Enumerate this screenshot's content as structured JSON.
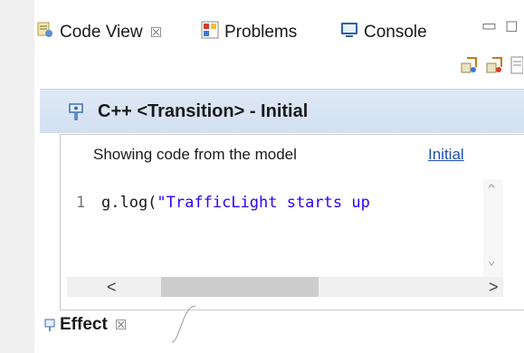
{
  "tabs": [
    {
      "label": "Code View",
      "icon": "code-view-icon",
      "active": true,
      "closable": true,
      "close_glyph": "☒"
    },
    {
      "label": "Problems",
      "icon": "problems-icon",
      "active": false
    },
    {
      "label": "Console",
      "icon": "console-icon",
      "active": false
    }
  ],
  "window_controls": {
    "minimize_glyph": "▭",
    "maximize_glyph": "◻"
  },
  "toolbar": {
    "icons": [
      "model-link-icon",
      "model-unlink-icon",
      "document-icon"
    ]
  },
  "header": {
    "icon": "transition-icon",
    "title": "C++ <Transition> - Initial"
  },
  "info": {
    "text": "Showing code from the model",
    "link": "Initial"
  },
  "editor": {
    "line_numbers": [
      "1"
    ],
    "code_prefix": "g.log(",
    "code_string": "\"TrafficLight starts up",
    "scroll_up": "^",
    "scroll_down": "⌄"
  },
  "hscroll": {
    "left": "<",
    "right": ">"
  },
  "bottom_tab": {
    "icon": "effect-icon",
    "label": "Effect",
    "close_glyph": "☒"
  },
  "colors": {
    "accent_blue": "#1b4fb5",
    "header_bg": "#d8e4f2",
    "string_color": "#2a00ff"
  }
}
